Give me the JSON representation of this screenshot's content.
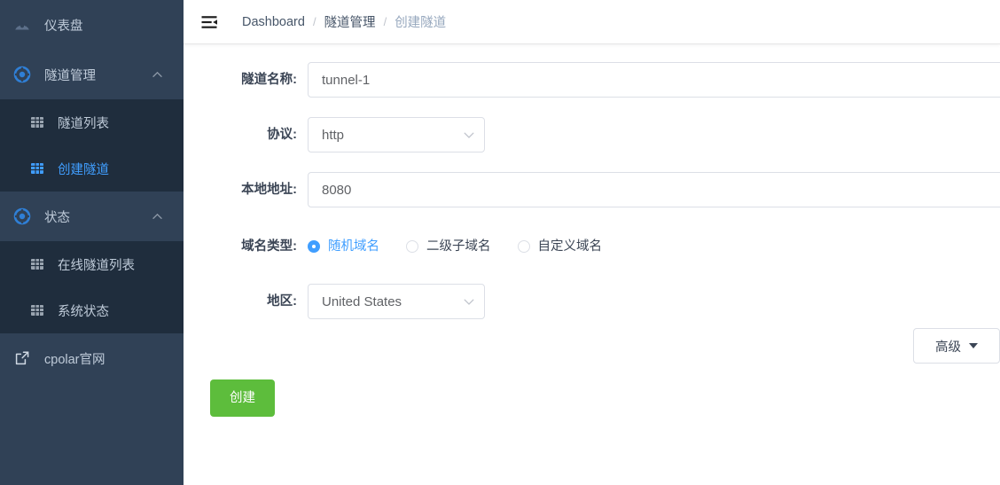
{
  "sidebar": {
    "items": [
      {
        "label": "仪表盘",
        "icon": "dashboard-icon",
        "type": "item",
        "active": false
      },
      {
        "label": "隧道管理",
        "icon": "tunnel-icon",
        "type": "group",
        "expanded": true,
        "chevron": "chevron-up-icon"
      },
      {
        "label": "状态",
        "icon": "status-icon",
        "type": "group",
        "expanded": true,
        "chevron": "chevron-up-icon"
      },
      {
        "label": "cpolar官网",
        "icon": "external-link-icon",
        "type": "link",
        "active": false
      }
    ],
    "tunnel_submenu": [
      {
        "label": "隧道列表",
        "icon": "grid-icon",
        "selected": false
      },
      {
        "label": "创建隧道",
        "icon": "grid-icon",
        "selected": true
      }
    ],
    "status_submenu": [
      {
        "label": "在线隧道列表",
        "icon": "grid-icon",
        "selected": false
      },
      {
        "label": "系统状态",
        "icon": "grid-icon",
        "selected": false
      }
    ]
  },
  "topbar": {
    "menu_toggle_icon": "menu-fold-icon",
    "breadcrumb": [
      {
        "label": "Dashboard",
        "muted": false
      },
      {
        "label": "隧道管理",
        "muted": false
      },
      {
        "label": "创建隧道",
        "muted": true
      }
    ],
    "separator": "/"
  },
  "form": {
    "tunnel_name": {
      "label": "隧道名称:",
      "value": "tunnel-1",
      "placeholder": "隧道名称"
    },
    "protocol": {
      "label": "协议:",
      "value": "http",
      "caret_icon": "chevron-down-icon"
    },
    "local_address": {
      "label": "本地地址:",
      "value": "8080",
      "placeholder": "本地地址"
    },
    "domain_type": {
      "label": "域名类型:",
      "options": [
        {
          "label": "随机域名",
          "checked": true
        },
        {
          "label": "二级子域名",
          "checked": false
        },
        {
          "label": "自定义域名",
          "checked": false
        }
      ]
    },
    "region": {
      "label": "地区:",
      "value": "United States",
      "caret_icon": "chevron-down-icon"
    },
    "advanced": {
      "label": "高级",
      "caret_icon": "triangle-down-icon"
    },
    "submit": {
      "label": "创建"
    }
  },
  "colors": {
    "sidebar_bg": "#304156",
    "submenu_bg": "#1f2d3d",
    "accent_blue": "#409eff",
    "sidebar_text": "#bfcbd9",
    "create_green": "#5dbd3c",
    "border": "#dcdfe6",
    "breadcrumb_muted": "#97a8be"
  }
}
